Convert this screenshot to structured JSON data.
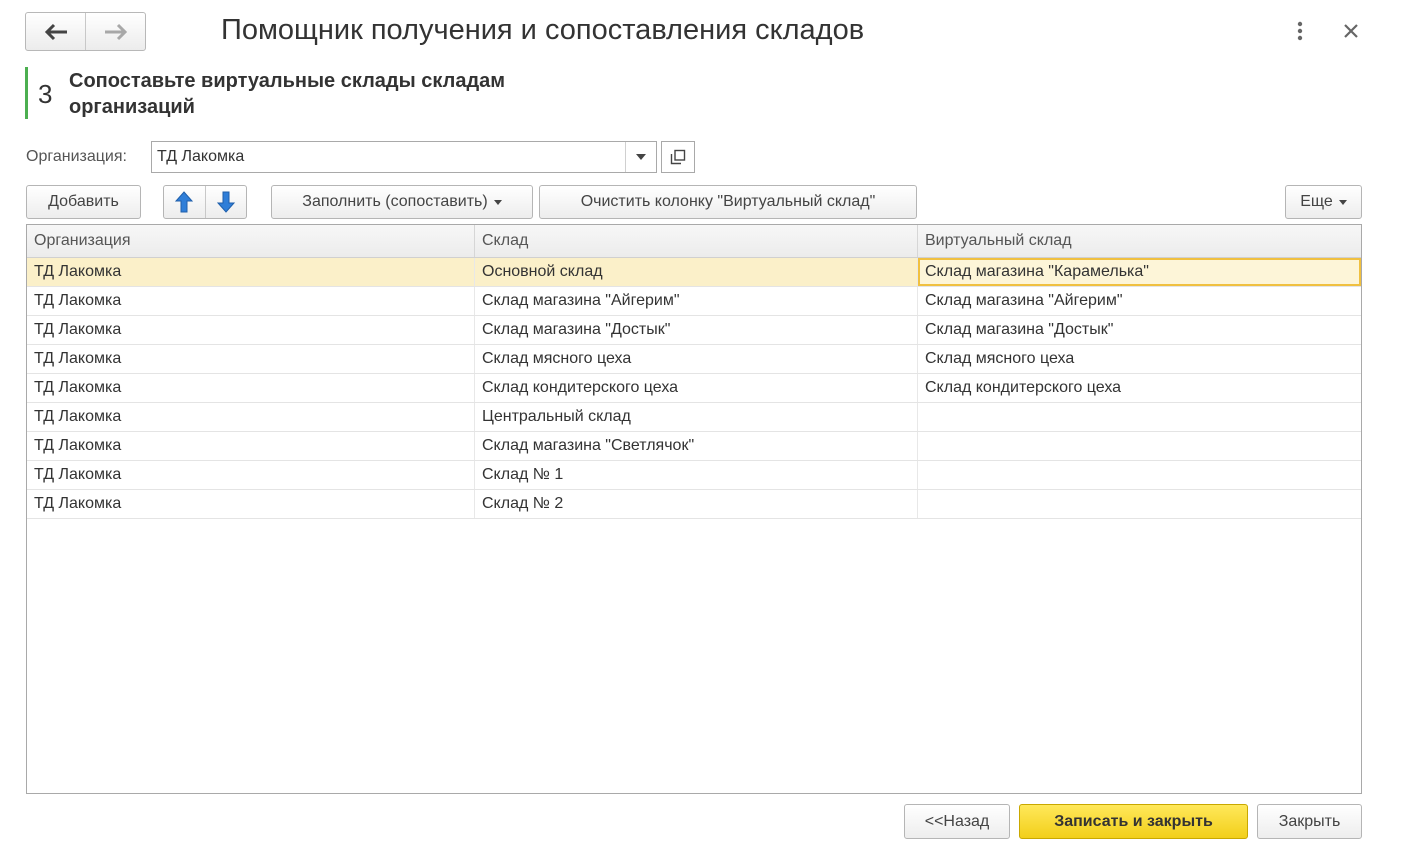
{
  "window": {
    "title": "Помощник получения и сопоставления складов"
  },
  "step": {
    "number": "3",
    "title": "Сопоставьте виртуальные склады складам организаций"
  },
  "organization": {
    "label": "Организация:",
    "value": "ТД Лакомка"
  },
  "toolbar": {
    "add_label": "Добавить",
    "fill_label": "Заполнить (сопоставить)",
    "clear_label": "Очистить колонку \"Виртуальный склад\"",
    "more_label": "Еще"
  },
  "table": {
    "columns": [
      "Организация",
      "Склад",
      "Виртуальный склад"
    ],
    "rows": [
      {
        "org": "ТД Лакомка",
        "warehouse": "Основной склад",
        "virtual": "Склад магазина \"Карамелька\""
      },
      {
        "org": "ТД Лакомка",
        "warehouse": "Склад магазина \"Айгерим\"",
        "virtual": "Склад магазина \"Айгерим\""
      },
      {
        "org": "ТД Лакомка",
        "warehouse": "Склад магазина \"Достык\"",
        "virtual": "Склад магазина \"Достык\""
      },
      {
        "org": "ТД Лакомка",
        "warehouse": "Склад мясного цеха",
        "virtual": "Склад мясного цеха"
      },
      {
        "org": "ТД Лакомка",
        "warehouse": "Склад кондитерского цеха",
        "virtual": "Склад кондитерского цеха"
      },
      {
        "org": "ТД Лакомка",
        "warehouse": "Центральный склад",
        "virtual": ""
      },
      {
        "org": "ТД Лакомка",
        "warehouse": "Склад магазина \"Светлячок\"",
        "virtual": ""
      },
      {
        "org": "ТД Лакомка",
        "warehouse": "Склад № 1",
        "virtual": ""
      },
      {
        "org": "ТД Лакомка",
        "warehouse": "Склад № 2",
        "virtual": ""
      }
    ]
  },
  "footer": {
    "back_label": "<<Назад",
    "save_close_label": "Записать и закрыть",
    "close_label": "Закрыть"
  },
  "colors": {
    "accent_green": "#4caf50",
    "primary_button": "#f2cf1a",
    "selected_row": "#fbf0c9",
    "arrow_blue": "#2f7ed8"
  },
  "icons": [
    "back-arrow-icon",
    "forward-arrow-icon",
    "more-vertical-icon",
    "close-icon",
    "chevron-down-icon",
    "open-window-icon",
    "arrow-up-icon",
    "arrow-down-icon"
  ]
}
